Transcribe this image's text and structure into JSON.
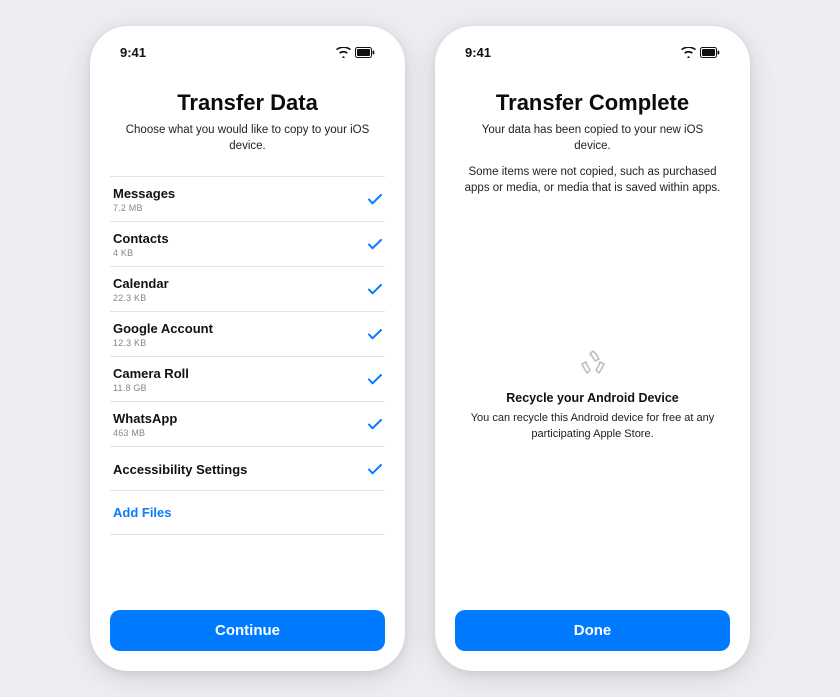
{
  "status": {
    "time": "9:41"
  },
  "left": {
    "title": "Transfer Data",
    "subtitle": "Choose what you would like to copy to your iOS device.",
    "items": [
      {
        "label": "Messages",
        "size": "7.2 MB"
      },
      {
        "label": "Contacts",
        "size": "4 KB"
      },
      {
        "label": "Calendar",
        "size": "22.3 KB"
      },
      {
        "label": "Google Account",
        "size": "12.3 KB"
      },
      {
        "label": "Camera Roll",
        "size": "11.8 GB"
      },
      {
        "label": "WhatsApp",
        "size": "463 MB"
      },
      {
        "label": "Accessibility Settings",
        "size": ""
      }
    ],
    "add_files": "Add Files",
    "button": "Continue"
  },
  "right": {
    "title": "Transfer Complete",
    "subtitle": "Your data has been copied to your new iOS device.",
    "extra": "Some items were not copied, such as purchased apps or media, or media that is saved within apps.",
    "recycle_title": "Recycle your Android Device",
    "recycle_desc": "You can recycle this Android device for free at any participating Apple Store.",
    "button": "Done"
  }
}
